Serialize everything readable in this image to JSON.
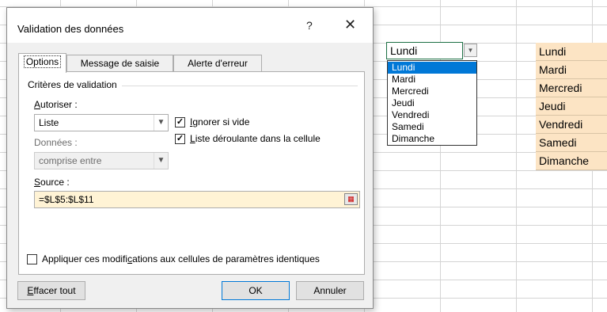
{
  "sheet": {
    "active_cell_value": "Lundi",
    "dropdown_items": [
      "Lundi",
      "Mardi",
      "Mercredi",
      "Jeudi",
      "Vendredi",
      "Samedi",
      "Dimanche"
    ],
    "dropdown_selected": "Lundi",
    "source_cells": [
      "Lundi",
      "Mardi",
      "Mercredi",
      "Jeudi",
      "Vendredi",
      "Samedi",
      "Dimanche"
    ],
    "source_highlight_color": "#fce4c4"
  },
  "dialog": {
    "title": "Validation des données",
    "help_label": "?",
    "close_label": "✕",
    "tabs": [
      "Options",
      "Message de saisie",
      "Alerte d'erreur"
    ],
    "criteria_label": "Critères de validation",
    "autoriser_label": "Autoriser :",
    "autoriser_value": "Liste",
    "donnees_label": "Données :",
    "donnees_value": "comprise entre",
    "ignorer_label": "Ignorer si vide",
    "ignorer_checked": true,
    "liste_label": "Liste déroulante dans la cellule",
    "liste_checked": true,
    "source_label": "Source :",
    "source_value": "=$L$5:$L$11",
    "appliquer_label": "Appliquer ces modifications aux cellules de paramètres identiques",
    "appliquer_checked": false,
    "effacer_label": "Effacer tout",
    "ok_label": "OK",
    "annuler_label": "Annuler"
  }
}
